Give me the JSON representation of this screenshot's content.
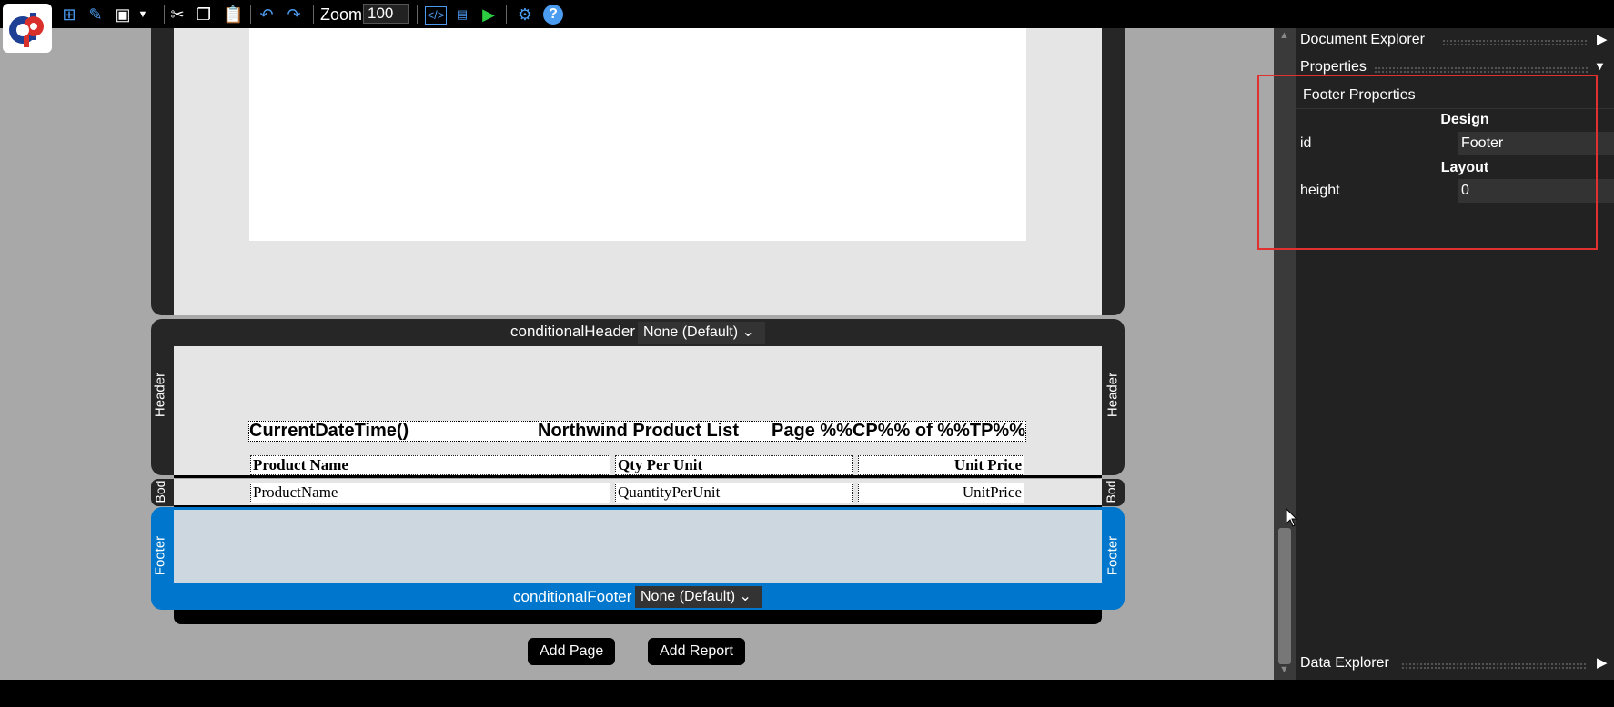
{
  "toolbar": {
    "zoom_label": "Zoom",
    "zoom_value": "100",
    "icons": [
      "add-report-icon",
      "edit-icon",
      "save-icon",
      "dropdown-icon",
      "cut-icon",
      "copy-icon",
      "paste-icon",
      "undo-icon",
      "redo-icon",
      "code-icon",
      "preview-icon",
      "run-icon",
      "settings-icon",
      "help-icon"
    ]
  },
  "canvas": {
    "header_band_label": "Header",
    "body_band_label": "Bod",
    "footer_band_label": "Footer",
    "conditional_header_label": "conditionalHeader",
    "conditional_header_value": "None (Default)",
    "conditional_footer_label": "conditionalFooter",
    "conditional_footer_value": "None (Default)",
    "header_row": {
      "datetime": "CurrentDateTime()",
      "title": "Northwind Product List",
      "page": "Page %%CP%% of %%TP%%"
    },
    "columns": [
      "Product Name",
      "Qty Per Unit",
      "Unit Price"
    ],
    "fields": [
      "ProductName",
      "QuantityPerUnit",
      "UnitPrice"
    ],
    "add_page": "Add Page",
    "add_report": "Add Report"
  },
  "panel": {
    "document_explorer": "Document Explorer",
    "properties": "Properties",
    "section_title": "Footer Properties",
    "groups": [
      "Design",
      "Layout"
    ],
    "props": [
      {
        "name": "id",
        "value": "Footer"
      },
      {
        "name": "height",
        "value": "0"
      }
    ],
    "data_explorer": "Data Explorer"
  },
  "colors": {
    "accent": "#0077cc",
    "highlight_box": "#e03030",
    "footer_fill": "#cdd7e0"
  }
}
